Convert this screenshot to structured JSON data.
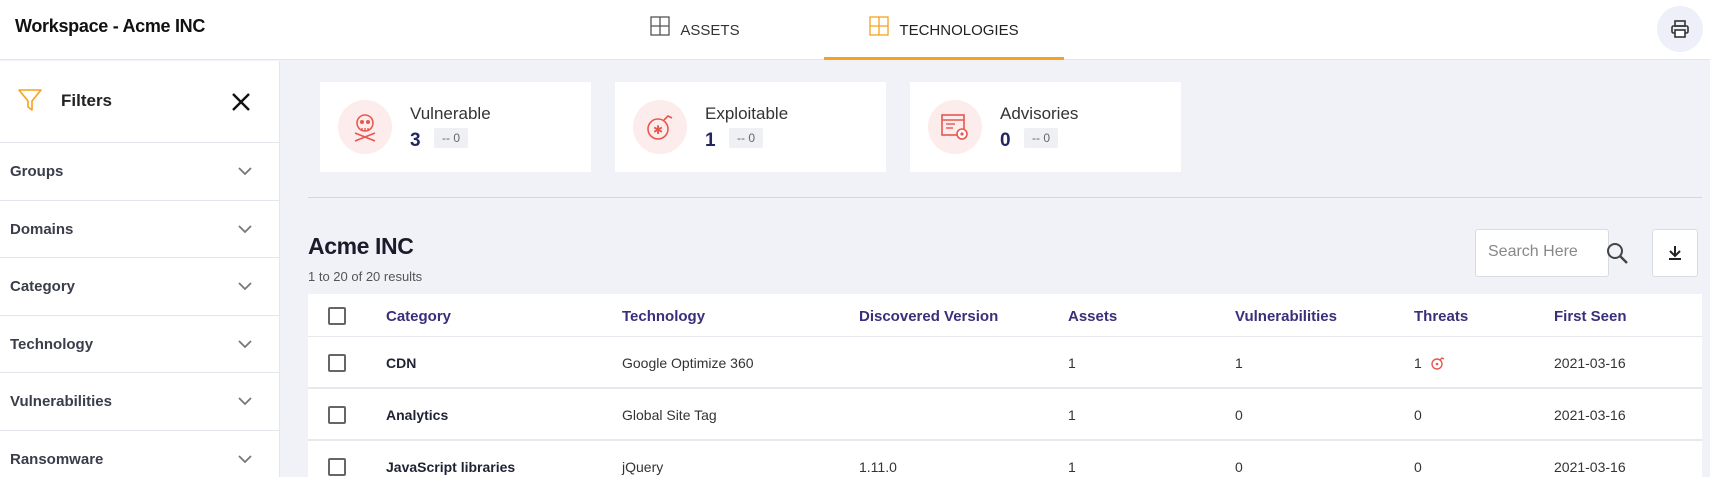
{
  "header": {
    "workspace_title": "Workspace - Acme INC",
    "tabs": [
      {
        "label": "ASSETS",
        "icon": "grid-icon",
        "active": false
      },
      {
        "label": "TECHNOLOGIES",
        "icon": "grid-icon",
        "active": true
      }
    ],
    "print_icon": "printer-icon",
    "active_tab_color": "#f6a21d"
  },
  "sidebar": {
    "title": "Filters",
    "items": [
      {
        "label": "Groups"
      },
      {
        "label": "Domains"
      },
      {
        "label": "Category"
      },
      {
        "label": "Technology"
      },
      {
        "label": "Vulnerabilities"
      },
      {
        "label": "Ransomware"
      }
    ]
  },
  "summary_cards": [
    {
      "label": "Vulnerable",
      "value": "3",
      "delta": "-- 0",
      "icon": "skull-icon"
    },
    {
      "label": "Exploitable",
      "value": "1",
      "delta": "-- 0",
      "icon": "bomb-icon"
    },
    {
      "label": "Advisories",
      "value": "0",
      "delta": "-- 0",
      "icon": "advisory-gear-icon"
    }
  ],
  "main": {
    "title": "Acme INC",
    "results_text": "1 to 20 of 20 results",
    "search_placeholder": "Search Here"
  },
  "table": {
    "columns": [
      "Category",
      "Technology",
      "Discovered Version",
      "Assets",
      "Vulnerabilities",
      "Threats",
      "First Seen"
    ],
    "rows": [
      {
        "category": "CDN",
        "technology": "Google Optimize 360",
        "version": "",
        "assets": "1",
        "vulnerabilities": "1",
        "threats": "1",
        "threat_icon": true,
        "first_seen": "2021-03-16"
      },
      {
        "category": "Analytics",
        "technology": "Global Site Tag",
        "version": "",
        "assets": "1",
        "vulnerabilities": "0",
        "threats": "0",
        "threat_icon": false,
        "first_seen": "2021-03-16"
      },
      {
        "category": "JavaScript libraries",
        "technology": "jQuery",
        "version": "1.11.0",
        "assets": "1",
        "vulnerabilities": "0",
        "threats": "0",
        "threat_icon": false,
        "first_seen": "2021-03-16"
      }
    ]
  },
  "colors": {
    "accent": "#f6a21d",
    "header_link": "#3a2f7a",
    "danger": "#e8574f",
    "value": "#232760"
  }
}
